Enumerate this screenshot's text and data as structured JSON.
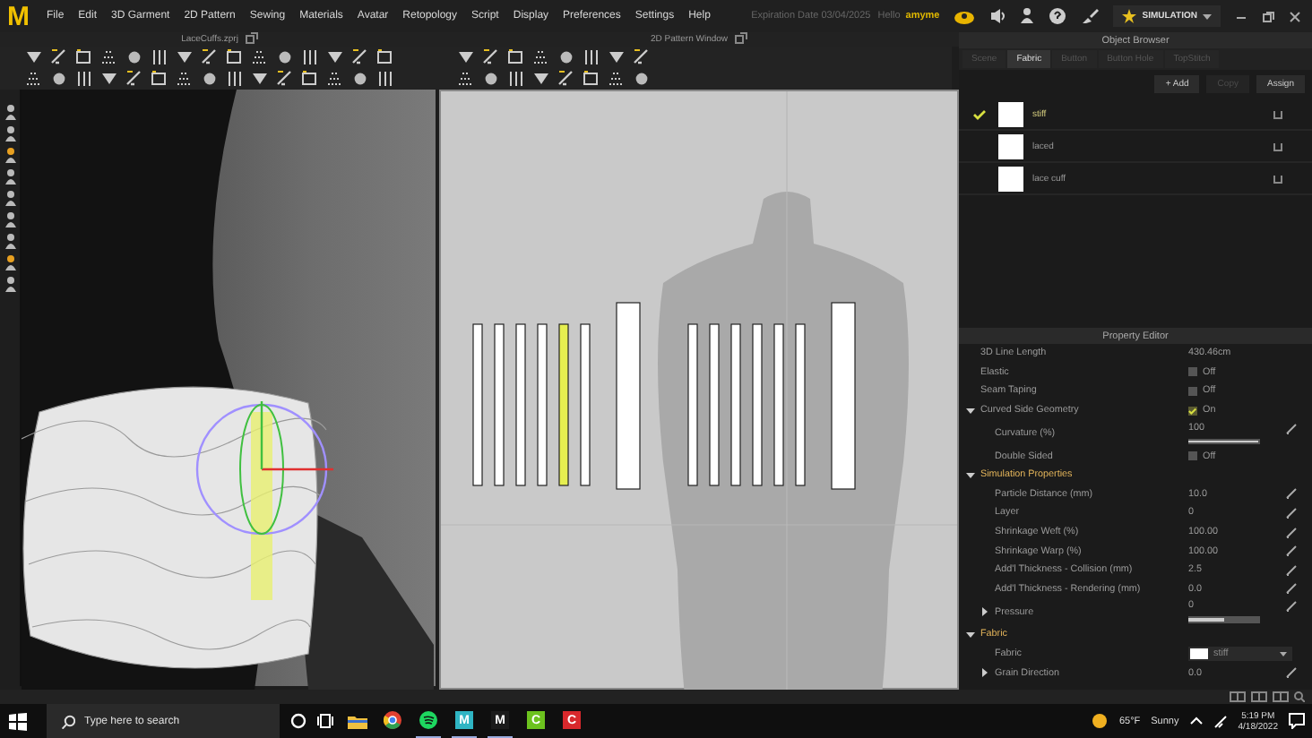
{
  "menu_bar": {
    "logo": "M",
    "items": [
      "File",
      "Edit",
      "3D Garment",
      "2D Pattern",
      "Sewing",
      "Materials",
      "Avatar",
      "Retopology",
      "Script",
      "Display",
      "Preferences",
      "Settings",
      "Help"
    ]
  },
  "header": {
    "expiration": "Expiration Date 03/04/2025",
    "greeting": "Hello",
    "user": "amyme",
    "mode_button": "SIMULATION"
  },
  "view_3d": {
    "title": "LaceCuffs.zprj"
  },
  "pattern_2d": {
    "title": "2D Pattern Window",
    "groups": [
      {
        "pieces": [
          {
            "kind": "strip",
            "selected": false
          },
          {
            "kind": "strip",
            "selected": false
          },
          {
            "kind": "strip",
            "selected": false
          },
          {
            "kind": "strip",
            "selected": false
          },
          {
            "kind": "strip",
            "selected": true
          },
          {
            "kind": "strip",
            "selected": false
          },
          {
            "kind": "panel",
            "selected": false
          }
        ]
      },
      {
        "pieces": [
          {
            "kind": "strip",
            "selected": false
          },
          {
            "kind": "strip",
            "selected": false
          },
          {
            "kind": "strip",
            "selected": false
          },
          {
            "kind": "strip",
            "selected": false
          },
          {
            "kind": "strip",
            "selected": false
          },
          {
            "kind": "strip",
            "selected": false
          },
          {
            "kind": "panel",
            "selected": false
          }
        ]
      }
    ]
  },
  "object_browser": {
    "title": "Object Browser",
    "tabs": [
      {
        "label": "Scene",
        "selected": false
      },
      {
        "label": "Fabric",
        "selected": true
      },
      {
        "label": "Button",
        "selected": false
      },
      {
        "label": "Button Hole",
        "selected": false
      },
      {
        "label": "TopStitch",
        "selected": false
      }
    ],
    "buttons": [
      {
        "label": "+ Add",
        "disabled": false
      },
      {
        "label": "Copy",
        "disabled": true
      },
      {
        "label": "Assign",
        "disabled": false
      }
    ],
    "items": [
      {
        "name": "stiff",
        "selected": true
      },
      {
        "name": "laced",
        "selected": false
      },
      {
        "name": "lace cuff",
        "selected": false
      }
    ]
  },
  "property_editor": {
    "title": "Property Editor",
    "rows": [
      {
        "kind": "value",
        "label": "3D Line Length",
        "value": "430.46cm",
        "editable": false
      },
      {
        "kind": "toggle",
        "label": "Elastic",
        "checked": false,
        "state": "Off"
      },
      {
        "kind": "toggle",
        "label": "Seam Taping",
        "checked": false,
        "state": "Off"
      },
      {
        "kind": "toggle",
        "label": "Curved Side Geometry",
        "checked": true,
        "state": "On",
        "expanded": true,
        "children": [
          {
            "kind": "slider",
            "label": "Curvature (%)",
            "value": "100",
            "level": 0.98
          },
          {
            "kind": "toggle",
            "label": "Double Sided",
            "checked": false,
            "state": "Off"
          }
        ]
      },
      {
        "kind": "section",
        "label": "Simulation Properties",
        "expanded": true,
        "children": [
          {
            "kind": "value",
            "label": "Particle Distance (mm)",
            "value": "10.0",
            "editable": true
          },
          {
            "kind": "value",
            "label": "Layer",
            "value": "0",
            "editable": true
          },
          {
            "kind": "value",
            "label": "Shrinkage Weft (%)",
            "value": "100.00",
            "editable": true
          },
          {
            "kind": "value",
            "label": "Shrinkage Warp (%)",
            "value": "100.00",
            "editable": true
          },
          {
            "kind": "value",
            "label": "Add'l Thickness - Collision (mm)",
            "value": "2.5",
            "editable": true
          },
          {
            "kind": "value",
            "label": "Add'l Thickness - Rendering (mm)",
            "value": "0.0",
            "editable": true
          },
          {
            "kind": "slider",
            "label": "Pressure",
            "value": "0",
            "level": 0.5,
            "expanded": false
          }
        ]
      },
      {
        "kind": "section",
        "label": "Fabric",
        "expanded": true,
        "children": [
          {
            "kind": "swatch",
            "label": "Fabric",
            "value": "stiff"
          },
          {
            "kind": "value",
            "label": "Grain Direction",
            "value": "0.0",
            "editable": true,
            "expanded": false
          }
        ]
      }
    ]
  },
  "taskbar": {
    "search": {
      "placeholder": "Type here to search"
    },
    "apps": [
      {
        "kind": "folder",
        "open": false
      },
      {
        "kind": "browser",
        "open": false
      },
      {
        "kind": "music",
        "open": true
      },
      {
        "kind": "letter",
        "glyph": "M",
        "color": "#2fb5c4",
        "open": true
      },
      {
        "kind": "letter",
        "glyph": "M",
        "color": "#1b1b1b",
        "open": true
      },
      {
        "kind": "letter",
        "glyph": "C",
        "color": "#6cc21e",
        "open": false
      },
      {
        "kind": "letter",
        "glyph": "C",
        "color": "#d8282c",
        "open": false
      }
    ],
    "weather": {
      "temperature": "65°F",
      "condition": "Sunny"
    },
    "time": "5:19 PM",
    "date": "4/18/2022"
  }
}
